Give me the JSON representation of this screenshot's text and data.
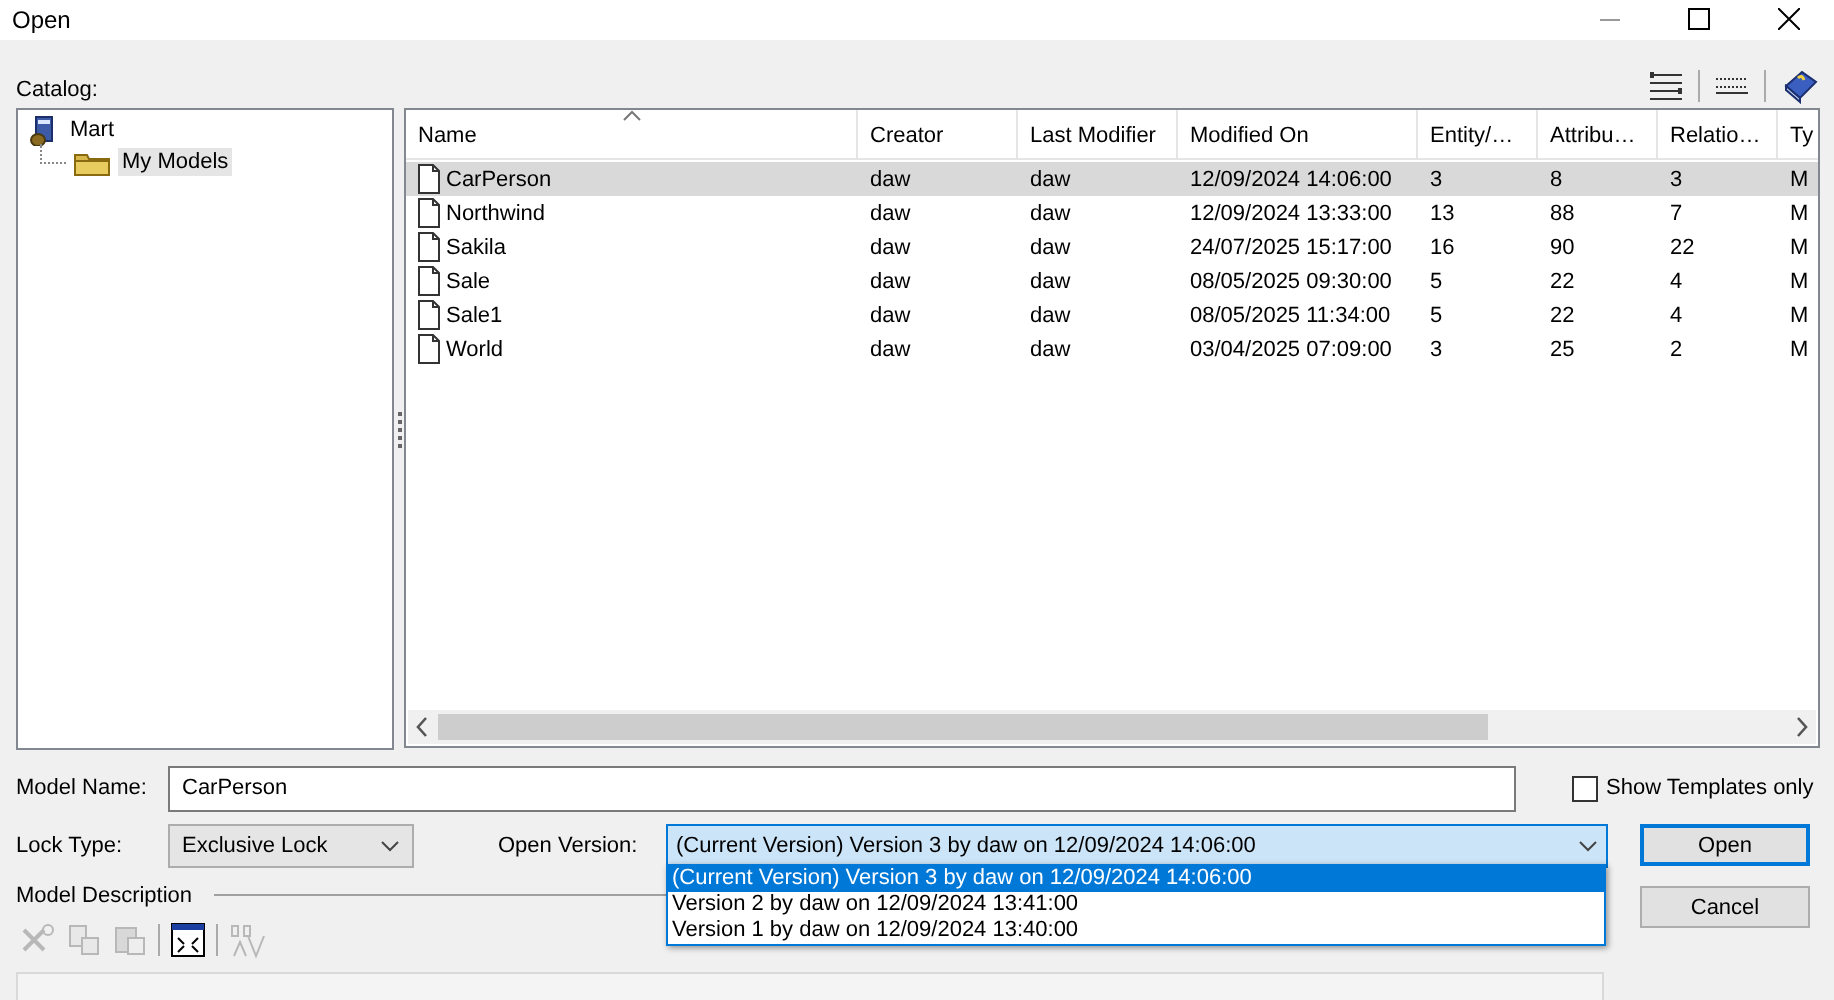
{
  "window": {
    "title": "Open"
  },
  "catalog": {
    "label": "Catalog:",
    "tree": [
      {
        "label": "Mart",
        "selected": false,
        "children": [
          {
            "label": "My Models",
            "selected": true
          }
        ]
      }
    ]
  },
  "table": {
    "columns": [
      {
        "label": "Name",
        "sorted": true
      },
      {
        "label": "Creator",
        "sorted": false
      },
      {
        "label": "Last Modifier",
        "sorted": false
      },
      {
        "label": "Modified On",
        "sorted": false
      },
      {
        "label": "Entity/…",
        "sorted": false
      },
      {
        "label": "Attribu…",
        "sorted": false
      },
      {
        "label": "Relatio…",
        "sorted": false
      },
      {
        "label": "Ty",
        "sorted": false
      }
    ],
    "rows": [
      {
        "selected": true,
        "cells": [
          "CarPerson",
          "daw",
          "daw",
          "12/09/2024 14:06:00",
          "3",
          "8",
          "3",
          "M"
        ]
      },
      {
        "selected": false,
        "cells": [
          "Northwind",
          "daw",
          "daw",
          "12/09/2024 13:33:00",
          "13",
          "88",
          "7",
          "M"
        ]
      },
      {
        "selected": false,
        "cells": [
          "Sakila",
          "daw",
          "daw",
          "24/07/2025 15:17:00",
          "16",
          "90",
          "22",
          "M"
        ]
      },
      {
        "selected": false,
        "cells": [
          "Sale",
          "daw",
          "daw",
          "08/05/2025 09:30:00",
          "5",
          "22",
          "4",
          "M"
        ]
      },
      {
        "selected": false,
        "cells": [
          "Sale1",
          "daw",
          "daw",
          "08/05/2025 11:34:00",
          "5",
          "22",
          "4",
          "M"
        ]
      },
      {
        "selected": false,
        "cells": [
          "World",
          "daw",
          "daw",
          "03/04/2025 07:09:00",
          "3",
          "25",
          "2",
          "M"
        ]
      }
    ]
  },
  "model_name": {
    "label": "Model Name:",
    "value": "CarPerson"
  },
  "show_templates": {
    "label": "Show Templates only",
    "checked": false
  },
  "lock_type": {
    "label": "Lock Type:",
    "value": "Exclusive Lock"
  },
  "open_version": {
    "label": "Open Version:",
    "value": "(Current Version) Version 3 by daw on 12/09/2024 14:06:00",
    "expanded": true,
    "options": [
      {
        "label": "(Current Version) Version 3 by daw on 12/09/2024 14:06:00",
        "selected": true
      },
      {
        "label": "Version 2 by daw on 12/09/2024 13:41:00",
        "selected": false
      },
      {
        "label": "Version 1 by daw on 12/09/2024 13:40:00",
        "selected": false
      }
    ]
  },
  "buttons": [
    {
      "label": "Open",
      "kind": "default"
    },
    {
      "label": "Cancel",
      "kind": "normal"
    }
  ],
  "model_description": {
    "label": "Model Description"
  }
}
